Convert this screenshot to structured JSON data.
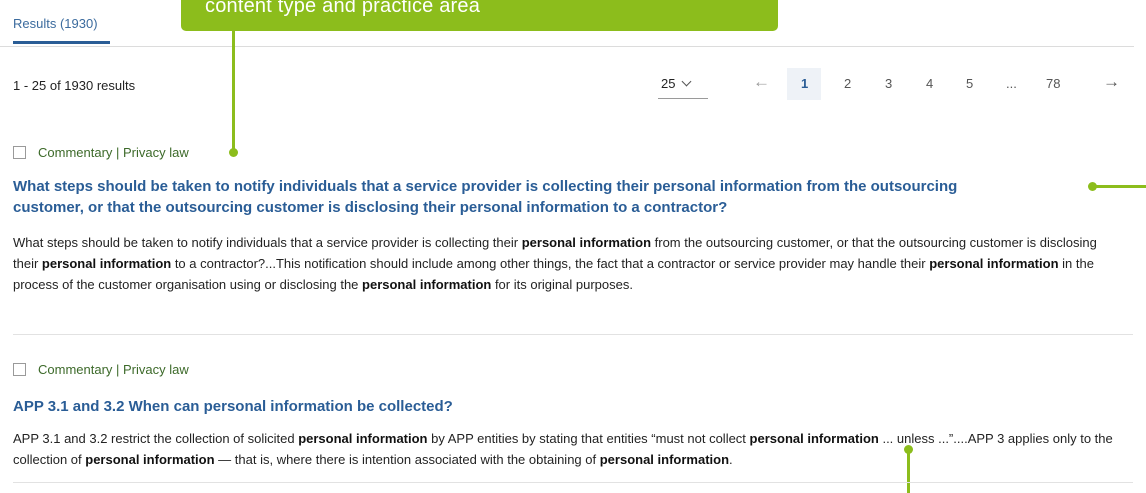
{
  "callout": {
    "text": "content type and practice area"
  },
  "tabs": [
    {
      "label": "Results (1930)"
    }
  ],
  "summary": {
    "text": "1 - 25 of 1930 results"
  },
  "per_page": {
    "value": "25"
  },
  "pagination": {
    "prev_glyph": "←",
    "next_glyph": "→",
    "pages": [
      "1",
      "2",
      "3",
      "4",
      "5",
      "...",
      "78"
    ],
    "current": "1"
  },
  "results": [
    {
      "meta": "Commentary | Privacy law",
      "title_line1": "What steps should be taken to notify individuals that a service provider is collecting their personal information from the outsourcing",
      "title_line2": "customer, or that the outsourcing customer is disclosing their personal information to a contractor?",
      "snippet": [
        {
          "t": "What steps should be taken to notify individuals that a service provider is collecting their "
        },
        {
          "b": "personal information"
        },
        {
          "t": " from the outsourcing customer, or that the outsourcing customer is disclosing their "
        },
        {
          "b": "personal information"
        },
        {
          "t": " to a contractor?...This notification should include among other things, the fact that a contractor or service provider may handle their "
        },
        {
          "b": "personal information"
        },
        {
          "t": " in the process of the customer organisation using or disclosing the "
        },
        {
          "b": "personal information"
        },
        {
          "t": " for its original purposes."
        }
      ]
    },
    {
      "meta": "Commentary | Privacy law",
      "title_line1": "APP 3.1 and 3.2 When can personal information be collected?",
      "snippet": [
        {
          "t": "APP 3.1 and 3.2 restrict the collection of solicited "
        },
        {
          "b": "personal information"
        },
        {
          "t": " by APP entities by stating that entities “must not collect "
        },
        {
          "b": "personal information"
        },
        {
          "t": " ... unless ...”....APP 3 applies only to the collection of "
        },
        {
          "b": "personal information"
        },
        {
          "t": " — that is, where there is intention associated with the obtaining of "
        },
        {
          "b": "personal information"
        },
        {
          "t": "."
        }
      ]
    }
  ],
  "colors": {
    "accent_green": "#8cbd1c",
    "link_blue": "#2a5d96",
    "meta_green": "#3d6a2a"
  }
}
